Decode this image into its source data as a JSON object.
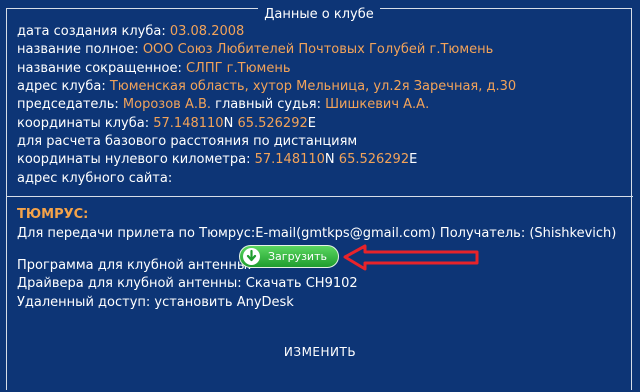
{
  "legend": "Данные о клубе",
  "club": {
    "created_label": "дата создания клуба:",
    "created_value": "03.08.2008",
    "full_name_label": "название полное:",
    "full_name_value": "ООО Союз Любителей Почтовых Голубей г.Тюмень",
    "short_name_label": "название сокращенное:",
    "short_name_value": "СЛПГ г.Тюмень",
    "address_label": "адрес клуба:",
    "address_value": "Тюменская область, хутор Мельница, ул.2я Заречная, д.30",
    "chairman_label": "председатель:",
    "chairman_value": "Морозов А.В.",
    "judge_label": "главный судья:",
    "judge_value": "Шишкевич А.А.",
    "coords_label": "координаты клуба:",
    "coords_lat": "57.148110",
    "coords_lat_suffix": "N",
    "coords_lon": "65.526292",
    "coords_lon_suffix": "E",
    "calc_note": "для расчета базового расстояния по дистанциям",
    "zero_km_label": "координаты нулевого километра:",
    "zero_lat": "57.148110",
    "zero_lat_suffix": "N",
    "zero_lon": "65.526292",
    "zero_lon_suffix": "E",
    "site_label": "адрес клубного сайта:"
  },
  "tiumrus": {
    "heading": "ТЮМРУС:",
    "transfer_text": "Для передачи прилета по Тюмрус:E-mail(gmtkps@gmail.com) Получатель: (Shishkevich)",
    "antenna_program_label": "Программа для клубной антенны:",
    "download_button": "Загрузить",
    "drivers_text": "Драйвера для клубной антенны: Скачать CH9102",
    "remote_text": "Удаленный доступ: установить AnyDesk"
  },
  "edit_label": "ИЗМЕНИТЬ",
  "colors": {
    "background": "#0d3576",
    "value": "#f2a35a",
    "heading": "#f5a349",
    "button": "#2fb53a",
    "arrow": "#e8232a"
  },
  "icons": {
    "download": "download-arrow-icon",
    "pointer": "red-arrow-icon"
  }
}
